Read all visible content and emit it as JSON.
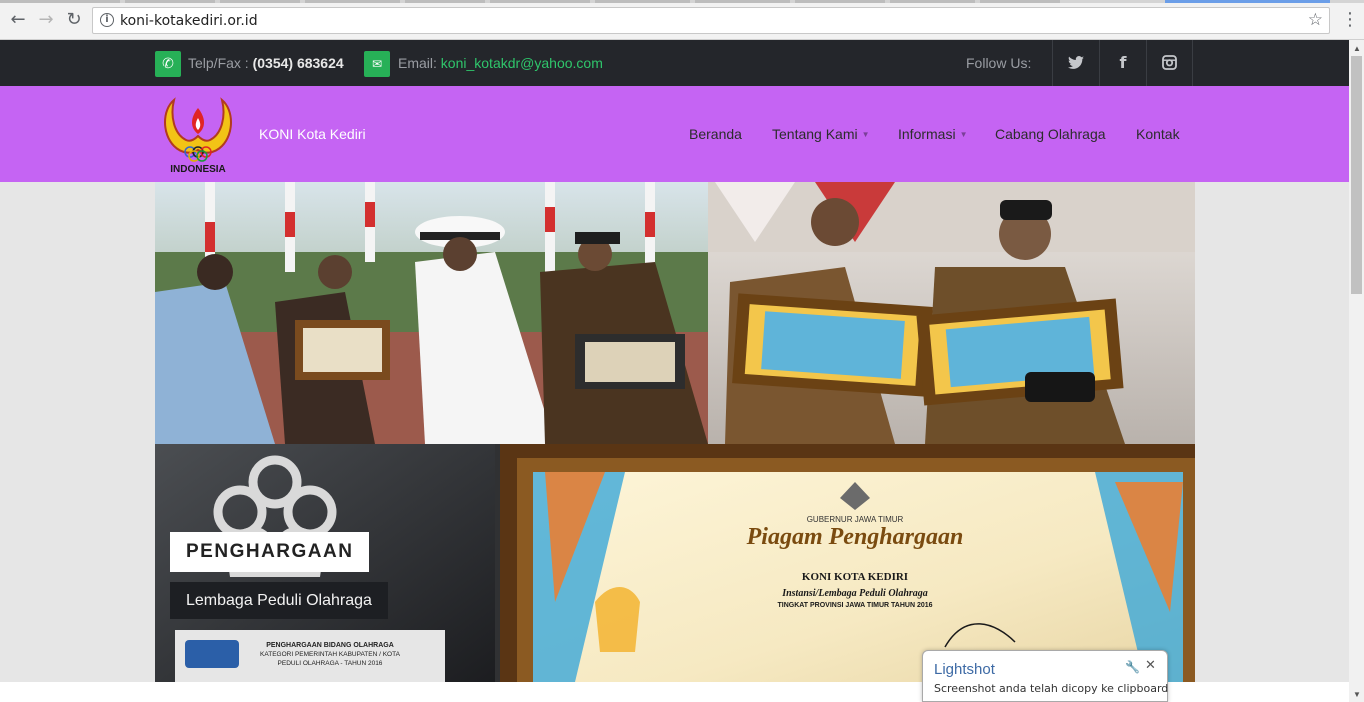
{
  "browser": {
    "url": "koni-kotakediri.or.id",
    "back_icon": "back-arrow-icon",
    "forward_icon": "forward-arrow-icon",
    "reload_icon": "reload-icon",
    "info_icon": "info-icon",
    "bookmark_icon": "star-icon",
    "menu_icon": "kebab-menu-icon"
  },
  "topbar": {
    "phone_label": "Telp/Fax : ",
    "phone_number": "(0354) 683624",
    "email_label": "Email: ",
    "email_address": "koni_kotakdr@yahoo.com",
    "follow_label": "Follow Us:",
    "social": [
      "twitter-icon",
      "facebook-icon",
      "instagram-icon"
    ]
  },
  "header": {
    "logo_text": "INDONESIA",
    "brand": "KONI Kota Kediri",
    "nav": [
      {
        "label": "Beranda",
        "dropdown": false
      },
      {
        "label": "Tentang Kami",
        "dropdown": true
      },
      {
        "label": "Informasi",
        "dropdown": true
      },
      {
        "label": "Cabang Olahraga",
        "dropdown": false
      },
      {
        "label": "Kontak",
        "dropdown": false
      }
    ]
  },
  "slider": {
    "title": "PENGHARGAAN",
    "subtitle": "Lembaga Peduli Olahraga",
    "certificate": {
      "issuer": "GUBERNUR JAWA TIMUR",
      "heading": "Piagam Penghargaan",
      "recipient": "KONI KOTA KEDIRI",
      "category": "Instansi/Lembaga Peduli Olahraga",
      "level": "TINGKAT PROVINSI JAWA TIMUR TAHUN 2016"
    },
    "plaque": [
      "PENGHARGAAN BIDANG OLAHRAGA",
      "KATEGORI PEMERINTAH KABUPATEN / KOTA",
      "PEDULI OLAHRAGA - TAHUN 2016"
    ]
  },
  "toast": {
    "title": "Lightshot",
    "message": "Screenshot anda telah dicopy ke clipboard"
  },
  "colors": {
    "topbar_bg": "#24262b",
    "header_bg": "#c564f3",
    "accent_green": "#27b057",
    "email_green": "#2fc56b"
  }
}
